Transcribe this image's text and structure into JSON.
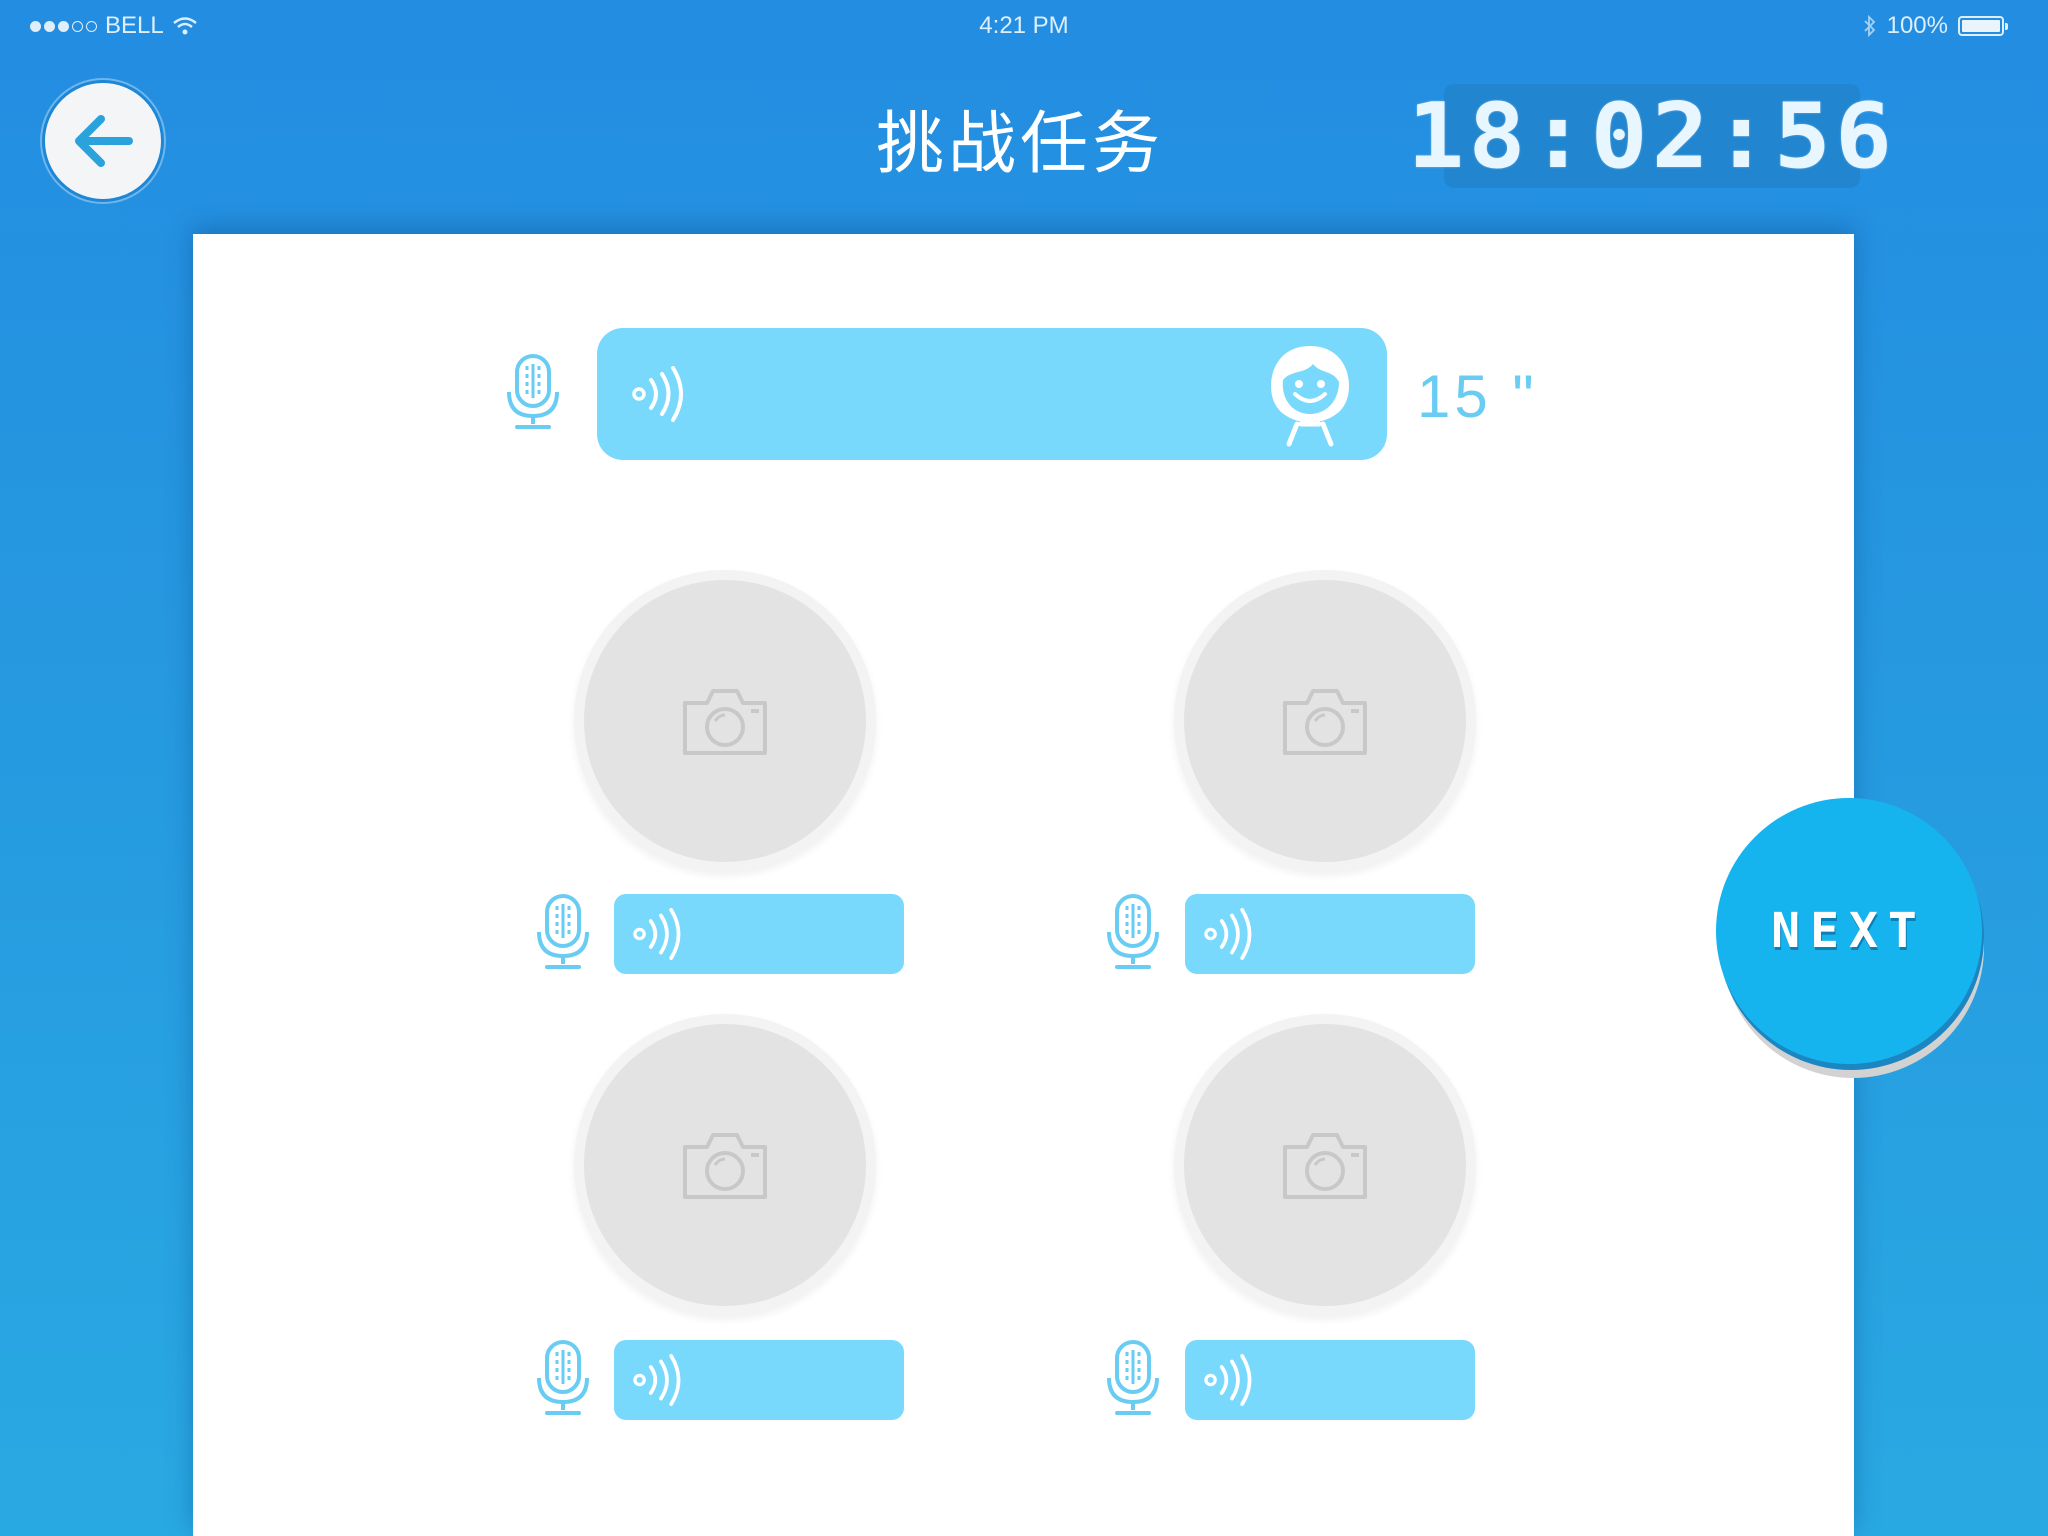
{
  "status_bar": {
    "carrier": "BELL",
    "time": "4:21 PM",
    "battery": "100%",
    "battery_level": 1.0
  },
  "header": {
    "title": "挑战任务",
    "timer": "18:02:56"
  },
  "prompt": {
    "duration": "15 \""
  },
  "next_button": {
    "label": "NEXT"
  },
  "colors": {
    "background_top": "#238de1",
    "background_bottom": "#29a9e2",
    "voice_bar": "#78d9fd",
    "mic_icon": "#68ccf3",
    "photo_placeholder": "#e3e3e3",
    "next_button": "#16b4ee"
  },
  "icons": {
    "back": "arrow-left-icon",
    "mic": "microphone-icon",
    "audio": "sound-waves-icon",
    "avatar": "girl-face-icon",
    "photo": "camera-icon",
    "status": [
      "wifi-icon",
      "bluetooth-icon",
      "battery-icon"
    ]
  }
}
